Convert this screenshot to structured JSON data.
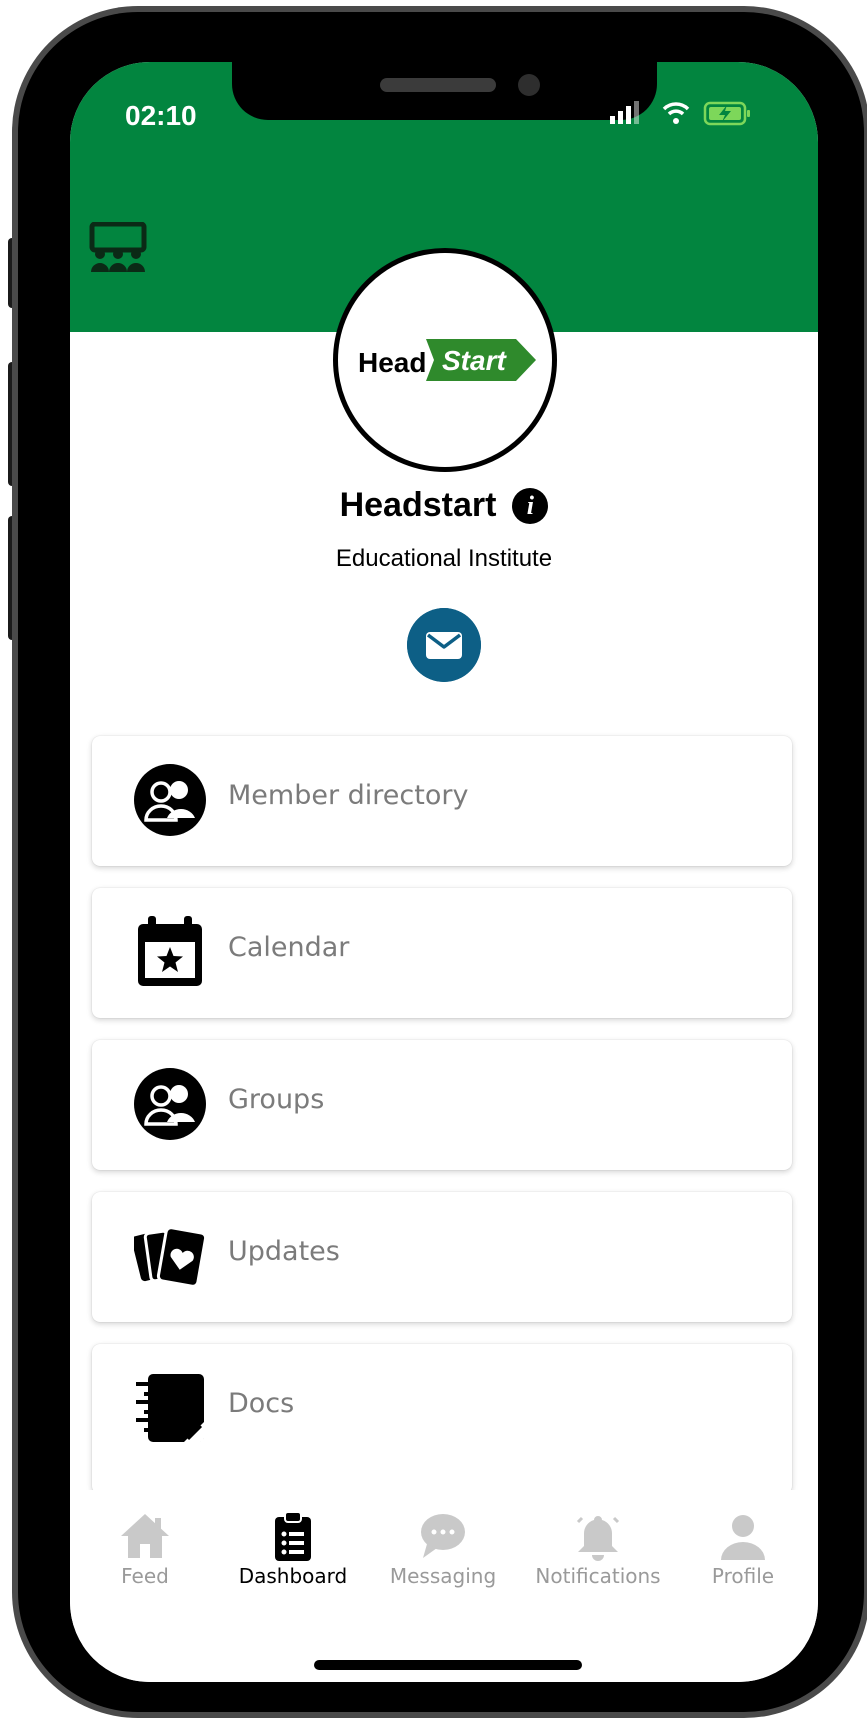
{
  "status_bar": {
    "time": "02:10"
  },
  "org": {
    "logo": {
      "head": "Head",
      "start": "Start"
    },
    "name": "Headstart",
    "type": "Educational Institute"
  },
  "menu": [
    {
      "label": "Member directory",
      "icon": "members-icon"
    },
    {
      "label": "Calendar",
      "icon": "calendar-star-icon"
    },
    {
      "label": "Groups",
      "icon": "groups-icon"
    },
    {
      "label": "Updates",
      "icon": "cards-heart-icon"
    },
    {
      "label": "Docs",
      "icon": "notebook-icon"
    }
  ],
  "tabs": [
    {
      "label": "Feed",
      "icon": "home-icon",
      "active": false
    },
    {
      "label": "Dashboard",
      "icon": "clipboard-icon",
      "active": true
    },
    {
      "label": "Messaging",
      "icon": "chat-bubble-icon",
      "active": false
    },
    {
      "label": "Notifications",
      "icon": "bell-icon",
      "active": false
    },
    {
      "label": "Profile",
      "icon": "person-icon",
      "active": false
    }
  ],
  "colors": {
    "brand_green": "#02853f",
    "mail_blue": "#0d5f86",
    "inactive_tab": "#9a9a9a"
  }
}
